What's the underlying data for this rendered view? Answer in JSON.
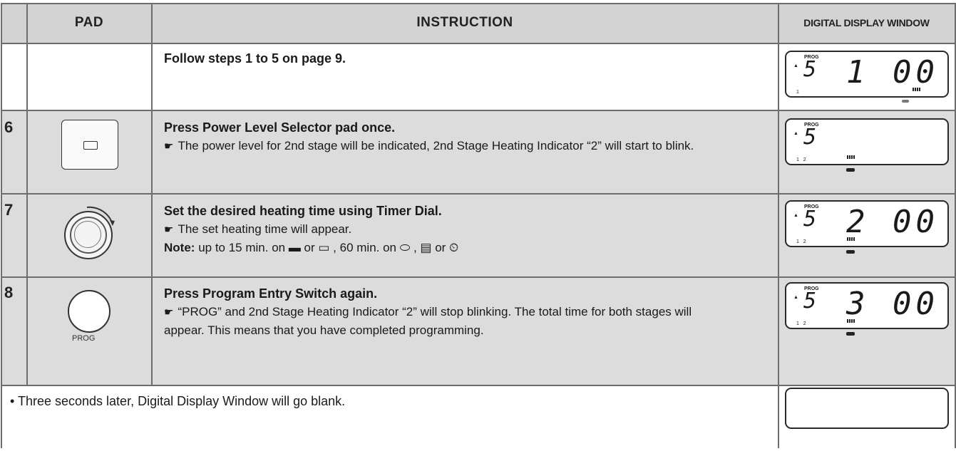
{
  "header": {
    "pad": "PAD",
    "instruction": "INSTRUCTION",
    "display": "DIGITAL DISPLAY WINDOW"
  },
  "rows": [
    {
      "step": "",
      "title": "Follow steps 1 to 5 on page 9.",
      "display": {
        "prog": "PROG",
        "power": "5",
        "time": "1 00"
      }
    },
    {
      "step": "6",
      "title": "Press Power Level Selector pad once.",
      "bullet": "The power level for 2nd stage will be indicated, 2nd Stage Heating Indicator “2” will start to blink.",
      "display": {
        "prog": "PROG",
        "power": "5",
        "time": ""
      }
    },
    {
      "step": "7",
      "title": "Set the desired heating time using Timer Dial.",
      "bullet": "The set heating time will appear.",
      "note_label": "Note:",
      "note": "up to 15 min. on ▬ or ▭ , 60 min. on ⬭ , ▤ or ⏲",
      "display": {
        "prog": "PROG",
        "power": "5",
        "time": "2 00"
      }
    },
    {
      "step": "8",
      "title": "Press Program Entry Switch again.",
      "bullet": "“PROG” and 2nd Stage Heating Indicator “2” will stop blinking. The total time for both stages will appear. This means that you have completed programming.",
      "pad_label": "PROG",
      "display": {
        "prog": "PROG",
        "power": "5",
        "time": "3 00"
      }
    }
  ],
  "footer": {
    "text": "•   Three seconds later, Digital Display Window will go blank."
  }
}
